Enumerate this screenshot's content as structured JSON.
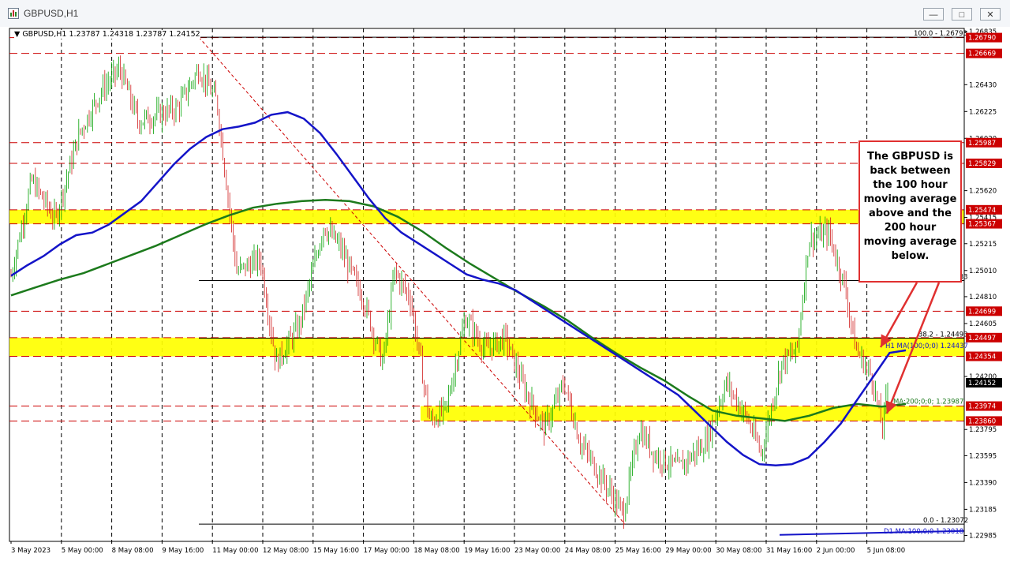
{
  "window": {
    "title": "GBPUSD,H1",
    "min_label": "—",
    "max_label": "□",
    "close_label": "✕"
  },
  "readout": "▼ GBPUSD,H1  1.23787 1.24318 1.23787 1.24152",
  "annotation": "The GBPUSD is back between the 100 hour moving average above and the 200 hour moving average below.",
  "chart_data": {
    "type": "candlestick",
    "symbol": "GBPUSD",
    "timeframe": "H1",
    "ohlc_readout": {
      "open": 1.23787,
      "high": 1.24318,
      "low": 1.23787,
      "close": 1.24152
    },
    "ylim": [
      1.2294,
      1.2686
    ],
    "price_ticks": [
      "1.26835",
      "1.26430",
      "1.26225",
      "1.26020",
      "1.25620",
      "1.25415",
      "1.25215",
      "1.25010",
      "1.24810",
      "1.24605",
      "1.24200",
      "1.23795",
      "1.23595",
      "1.23390",
      "1.23185",
      "1.22985"
    ],
    "x_tick_labels": [
      "3 May 2023",
      "5 May 00:00",
      "8 May 08:00",
      "9 May 16:00",
      "11 May 00:00",
      "12 May 08:00",
      "15 May 16:00",
      "17 May 00:00",
      "18 May 08:00",
      "19 May 16:00",
      "23 May 00:00",
      "24 May 08:00",
      "25 May 16:00",
      "29 May 00:00",
      "30 May 08:00",
      "31 May 16:00",
      "2 Jun 00:00",
      "5 Jun 08:00"
    ],
    "price_lines": [
      {
        "price": 1.2679,
        "label": "1.26790",
        "color": "#cc0000"
      },
      {
        "price": 1.26669,
        "label": "1.26669",
        "color": "#cc0000"
      },
      {
        "price": 1.25987,
        "label": "1.25987",
        "color": "#cc0000"
      },
      {
        "price": 1.25829,
        "label": "1.25829",
        "color": "#cc0000"
      },
      {
        "price": 1.25474,
        "label": "1.25474",
        "color": "#cc0000"
      },
      {
        "price": 1.25367,
        "label": "1.25367",
        "color": "#cc0000"
      },
      {
        "price": 1.24699,
        "label": "1.24699",
        "color": "#cc0000"
      },
      {
        "price": 1.24497,
        "label": "1.24497",
        "color": "#cc0000"
      },
      {
        "price": 1.24354,
        "label": "1.24354",
        "color": "#cc0000"
      },
      {
        "price": 1.23974,
        "label": "1.23974",
        "color": "#cc0000"
      },
      {
        "price": 1.2386,
        "label": "1.23860",
        "color": "#cc0000"
      }
    ],
    "current_price": {
      "price": 1.24152,
      "label": "1.24152"
    },
    "zones": [
      {
        "from": 1.25367,
        "to": 1.25474
      },
      {
        "from": 1.24354,
        "to": 1.24497
      },
      {
        "from": 1.2386,
        "to": 1.23974
      }
    ],
    "fib_levels": [
      {
        "label": "100.0 - 1.26793",
        "price": 1.26793
      },
      {
        "label": "50.0 - 1.24933",
        "price": 1.24933
      },
      {
        "label": "38.2 - 1.24493",
        "price": 1.24493
      },
      {
        "label": "0.0 - 1.23072",
        "price": 1.23072
      }
    ],
    "ma_labels": [
      {
        "label": "H1 MA(100;0;0) 1.24437",
        "price": 1.24437
      },
      {
        "label": "MA:200;0;0; 1.23987",
        "price": 1.23987
      },
      {
        "label": "D1 MA:100;0;0 1.23018",
        "price": 1.23018
      }
    ],
    "ma100_h1": [
      1.2497,
      1.2505,
      1.2512,
      1.2521,
      1.2528,
      1.253,
      1.2536,
      1.2545,
      1.2554,
      1.2568,
      1.2582,
      1.2594,
      1.2603,
      1.2609,
      1.2611,
      1.2614,
      1.262,
      1.2622,
      1.2617,
      1.2606,
      1.259,
      1.2573,
      1.2556,
      1.2541,
      1.253,
      1.2522,
      1.2514,
      1.2506,
      1.2498,
      1.2494,
      1.2491,
      1.2486,
      1.2478,
      1.247,
      1.2462,
      1.2454,
      1.2446,
      1.2438,
      1.243,
      1.2422,
      1.2414,
      1.2406,
      1.2394,
      1.2382,
      1.237,
      1.236,
      1.2353,
      1.2352,
      1.2353,
      1.2358,
      1.237,
      1.2384,
      1.2402,
      1.242,
      1.2438,
      1.244
    ],
    "ma200_h1": [
      1.2482,
      1.2488,
      1.2494,
      1.2499,
      1.2506,
      1.2513,
      1.252,
      1.2528,
      1.2536,
      1.2543,
      1.2549,
      1.2552,
      1.2554,
      1.2555,
      1.2554,
      1.255,
      1.2542,
      1.2531,
      1.2518,
      1.2506,
      1.2495,
      1.2484,
      1.2474,
      1.2463,
      1.245,
      1.2438,
      1.2427,
      1.2417,
      1.2405,
      1.2394,
      1.239,
      1.2388,
      1.2386,
      1.239,
      1.2396,
      1.2399,
      1.2397,
      1.2399
    ],
    "ma100_d1": [
      1.2299,
      1.23,
      1.2301,
      1.2302
    ]
  }
}
